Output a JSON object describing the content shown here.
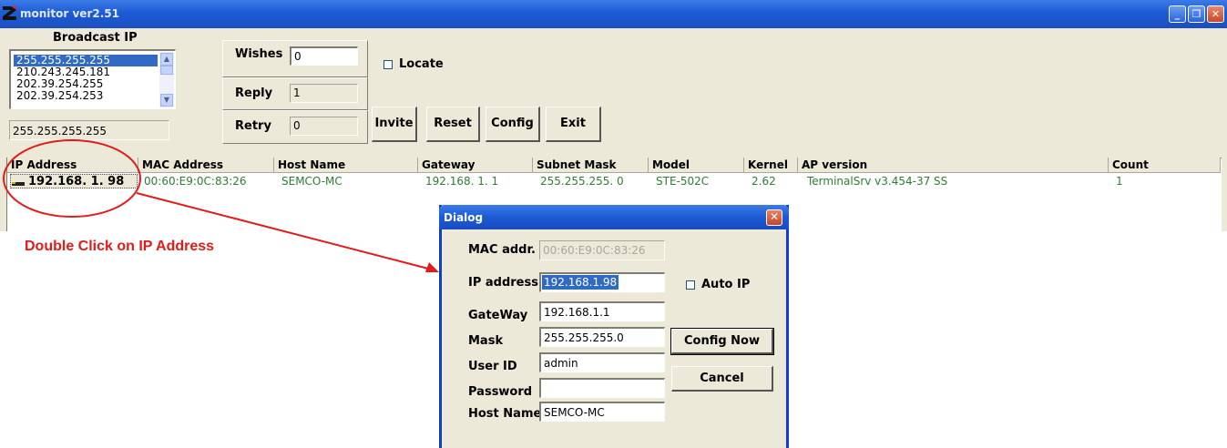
{
  "window": {
    "title": "monitor ver2.51",
    "controls": [
      "_",
      "❐",
      "✕"
    ]
  },
  "broadcast": {
    "label": "Broadcast IP",
    "items": [
      "255.255.255.255",
      "210.243.245.181",
      "202.39.254.255",
      "202.39.254.253"
    ],
    "selected_index": 0,
    "current_value": "255.255.255.255"
  },
  "counters": {
    "wishes_label": "Wishes",
    "wishes_value": "0",
    "reply_label": "Reply",
    "reply_value": "1",
    "retry_label": "Retry",
    "retry_value": "0"
  },
  "locate": {
    "label": "Locate",
    "checked": false
  },
  "buttons": {
    "invite": "Invite",
    "reset": "Reset",
    "config": "Config",
    "exit": "Exit"
  },
  "table": {
    "columns": [
      "IP Address",
      "MAC Address",
      "Host Name",
      "Gateway",
      "Subnet Mask",
      "Model",
      "Kernel",
      "AP version",
      "Count"
    ],
    "rows": [
      [
        "192.168. 1. 98",
        "00:60:E9:0C:83:26",
        "SEMCO-MC",
        "192.168. 1. 1",
        "255.255.255. 0",
        "STE-502C",
        "2.62",
        "TerminalSrv v3.454-37  SS",
        "1"
      ]
    ]
  },
  "annotation": {
    "text": "Double Click on IP Address",
    "color": "#e21a1a"
  },
  "dialog": {
    "title": "Dialog",
    "mac_label": "MAC addr.",
    "mac_value": "00:60:E9:0C:83:26",
    "ip_label": "IP address",
    "ip_value": "192.168.1.98",
    "gateway_label": "GateWay",
    "gateway_value": "192.168.1.1",
    "mask_label": "Mask",
    "mask_value": "255.255.255.0",
    "userid_label": "User ID",
    "userid_value": "admin",
    "password_label": "Password",
    "password_value": "",
    "hostname_label": "Host Name",
    "hostname_value": "SEMCO-MC",
    "autoip_label": "Auto IP",
    "autoip_checked": false,
    "config_now": "Config Now",
    "cancel": "Cancel"
  }
}
